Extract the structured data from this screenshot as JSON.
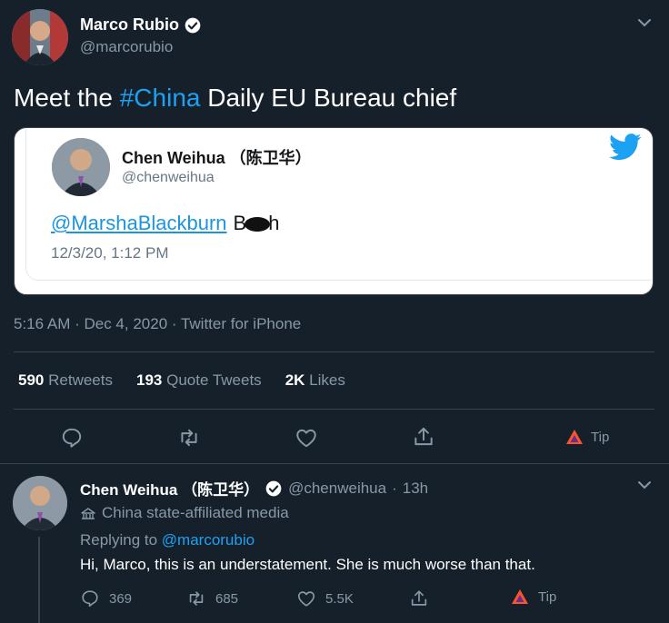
{
  "main_tweet": {
    "author_name": "Marco Rubio",
    "author_handle": "@marcorubio",
    "text_prefix": "Meet the ",
    "hashtag": "#China",
    "text_suffix": " Daily EU Bureau chief",
    "meta": "5:16 AM · Dec 4, 2020 · Twitter for iPhone",
    "stats": {
      "retweets_count": "590",
      "retweets_label": "Retweets",
      "quotes_count": "193",
      "quotes_label": "Quote Tweets",
      "likes_count": "2K",
      "likes_label": "Likes"
    },
    "tip_label": "Tip"
  },
  "embedded_tweet": {
    "author_name": "Chen Weihua （陈卫华）",
    "author_handle": "@chenweihua",
    "mention": "@MarshaBlackburn",
    "word_start": "B",
    "word_end": "h",
    "timestamp": "12/3/20, 1:12 PM"
  },
  "reply": {
    "author_name": "Chen Weihua （陈卫华）",
    "author_handle": "@chenweihua",
    "time_sep": "·",
    "time": "13h",
    "affiliation": "China state-affiliated media",
    "replying_prefix": "Replying to ",
    "replying_handle": "@marcorubio",
    "text": "Hi, Marco, this is an understatement.  She is much worse than that.",
    "replies": "369",
    "retweets": "685",
    "likes": "5.5K",
    "tip_label": "Tip"
  },
  "colors": {
    "background": "#15202b",
    "accent": "#1da1f2",
    "muted": "#8899a6",
    "divider": "#38444d"
  },
  "icons": [
    "verified-icon",
    "chevron-down-icon",
    "twitter-bird-icon",
    "reply-icon",
    "retweet-icon",
    "like-icon",
    "share-icon",
    "tip-icon",
    "state-media-icon"
  ]
}
